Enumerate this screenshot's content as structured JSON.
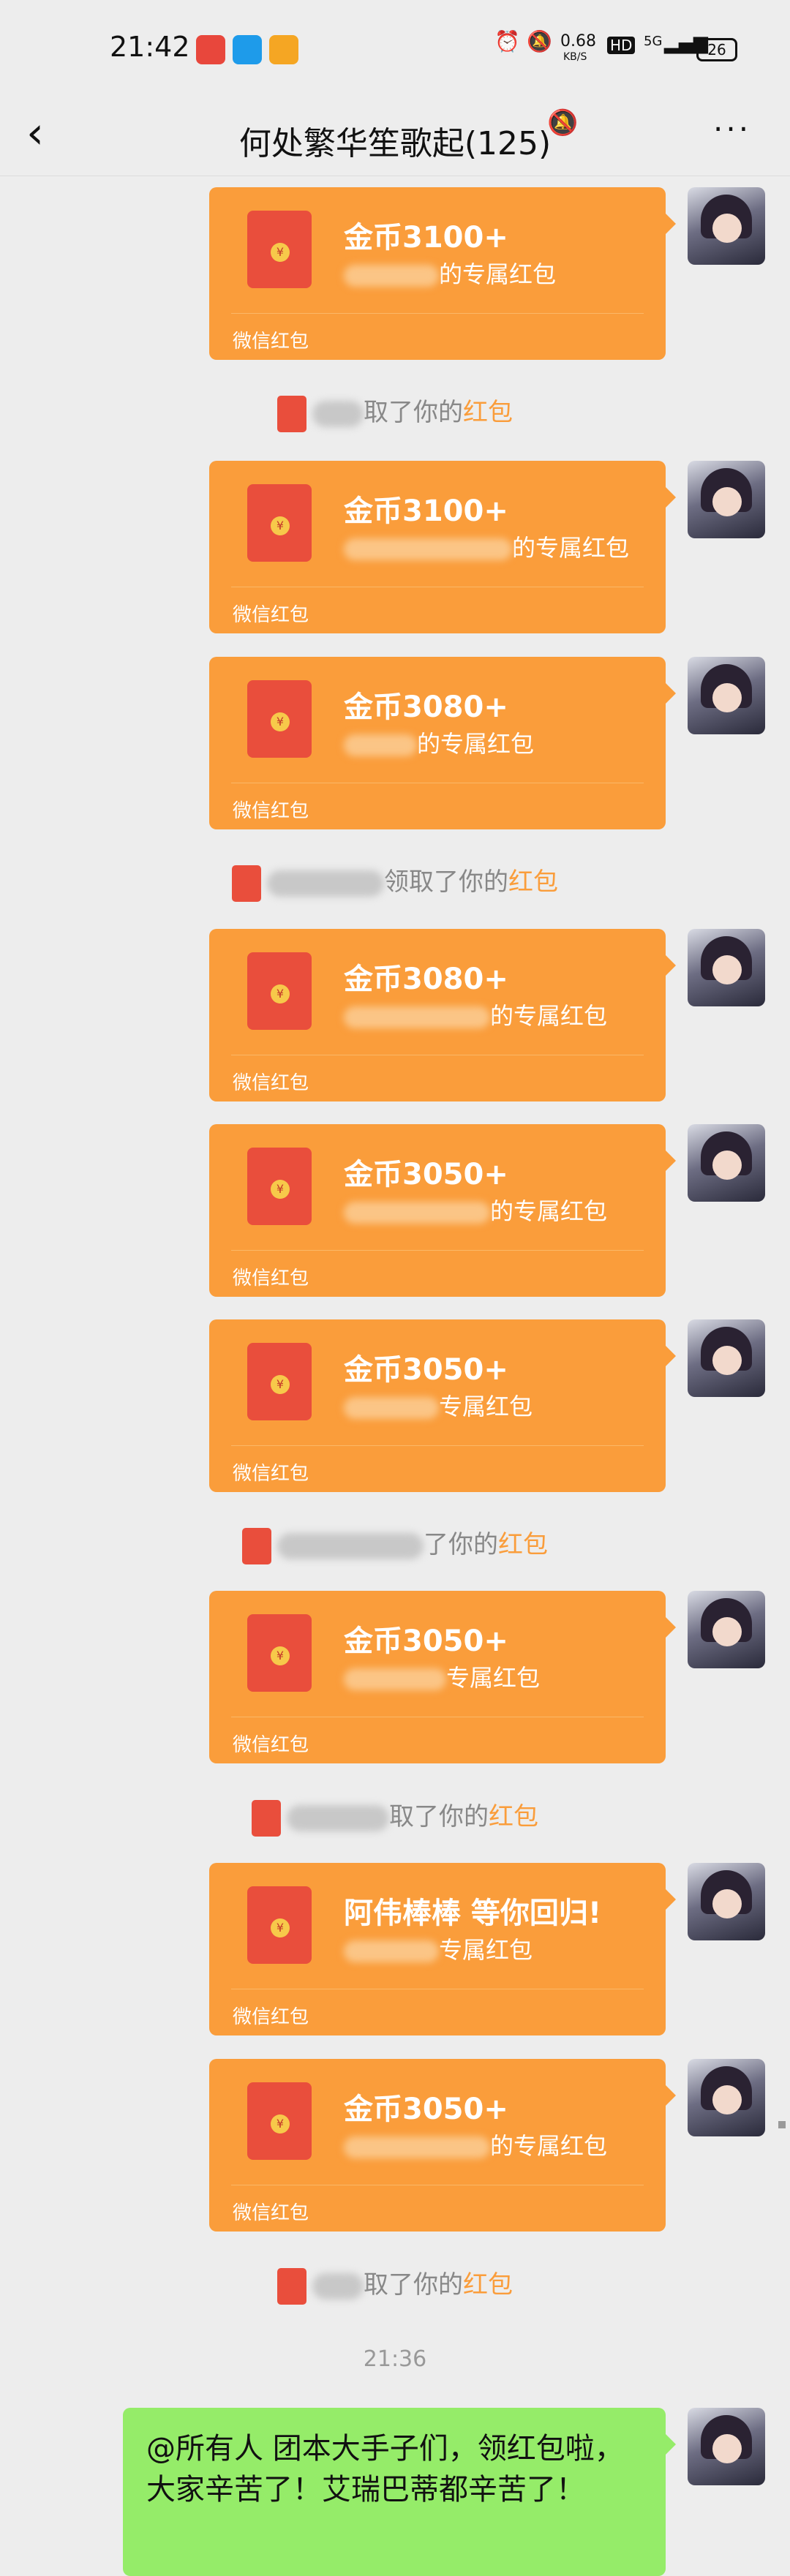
{
  "status_bar": {
    "time": "21:42",
    "network_speed": "0.68",
    "speed_unit": "KB/S",
    "hd": "HD",
    "signal": "5G",
    "battery": "26"
  },
  "nav": {
    "title": "何处繁华笙歌起(125)"
  },
  "red_packets": [
    {
      "amount": "金币3100+",
      "desc_suffix": "的专属红包",
      "footer": "微信红包"
    },
    {
      "amount": "金币3100+",
      "desc_suffix": "的专属红包",
      "footer": "微信红包"
    },
    {
      "amount": "金币3080+",
      "desc_suffix": "的专属红包",
      "footer": "微信红包"
    },
    {
      "amount": "金币3080+",
      "desc_suffix": "的专属红包",
      "footer": "微信红包"
    },
    {
      "amount": "金币3050+",
      "desc_suffix": "的专属红包",
      "footer": "微信红包"
    },
    {
      "amount": "金币3050+",
      "desc_suffix": "专属红包",
      "footer": "微信红包"
    },
    {
      "amount": "金币3050+",
      "desc_suffix": "专属红包",
      "footer": "微信红包"
    },
    {
      "amount": "阿伟棒棒 等你回归!",
      "desc_suffix": "专属红包",
      "footer": "微信红包"
    },
    {
      "amount": "金币3050+",
      "desc_suffix": "的专属红包",
      "footer": "微信红包"
    }
  ],
  "system_messages": [
    {
      "text": "取了你的",
      "link": "红包"
    },
    {
      "text": "领取了你的",
      "link": "红包"
    },
    {
      "text": "了你的",
      "link": "红包"
    },
    {
      "text": "取了你的",
      "link": "红包"
    },
    {
      "text": "取了你的",
      "link": "红包"
    }
  ],
  "timestamp": "21:36",
  "text_message": "@所有人 团本大手子们，领红包啦，大家辛苦了！艾瑞巴蒂都辛苦了！",
  "colors": {
    "packet": "#fa9d3b",
    "bubble": "#95ec69",
    "background": "#ededed"
  }
}
